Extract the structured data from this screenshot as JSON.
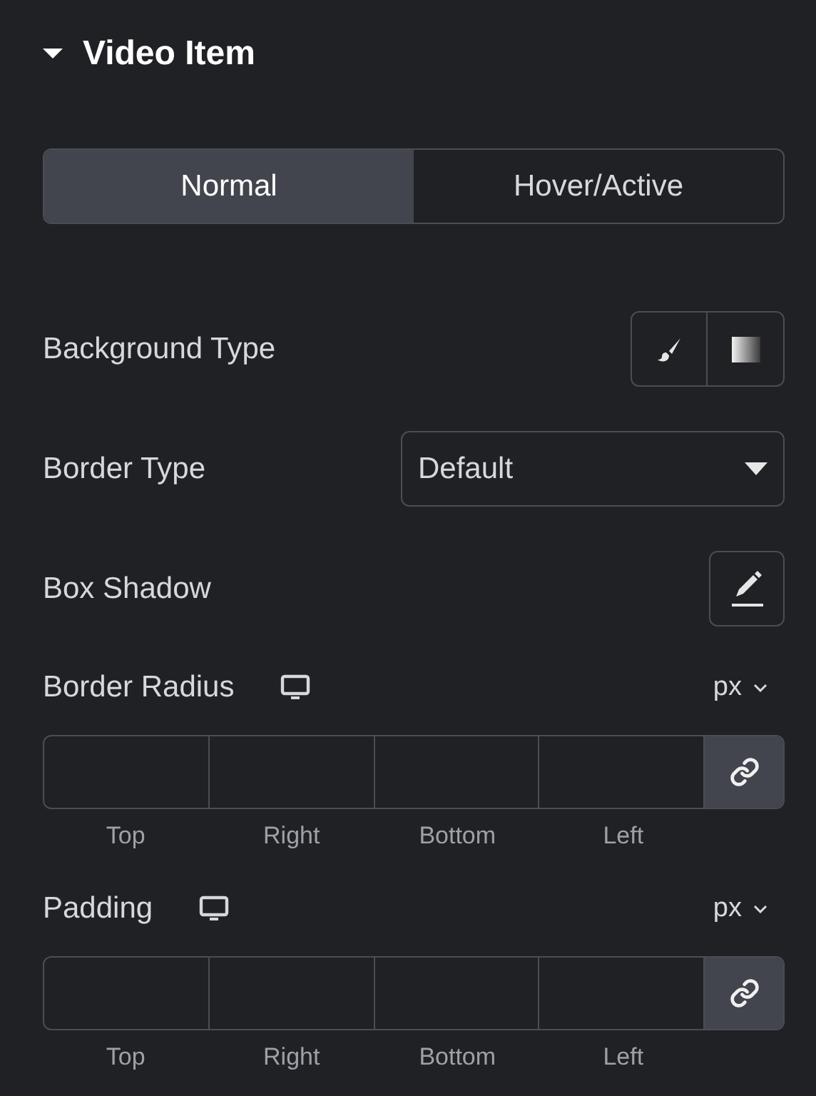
{
  "section": {
    "title": "Video Item",
    "expanded": true
  },
  "tabs": [
    {
      "label": "Normal",
      "selected": true
    },
    {
      "label": "Hover/Active",
      "selected": false
    }
  ],
  "controls": [
    {
      "kind": "choose",
      "label": "Background Type"
    },
    {
      "kind": "select",
      "label": "Border Type",
      "value": "Default"
    },
    {
      "kind": "edit",
      "label": "Box Shadow"
    },
    {
      "kind": "dimensions",
      "label": "Border Radius",
      "unit": "px",
      "linked": true,
      "sides": [
        "Top",
        "Right",
        "Bottom",
        "Left"
      ]
    },
    {
      "kind": "dimensions",
      "label": "Padding",
      "unit": "px",
      "linked": true,
      "sides": [
        "Top",
        "Right",
        "Bottom",
        "Left"
      ]
    }
  ]
}
